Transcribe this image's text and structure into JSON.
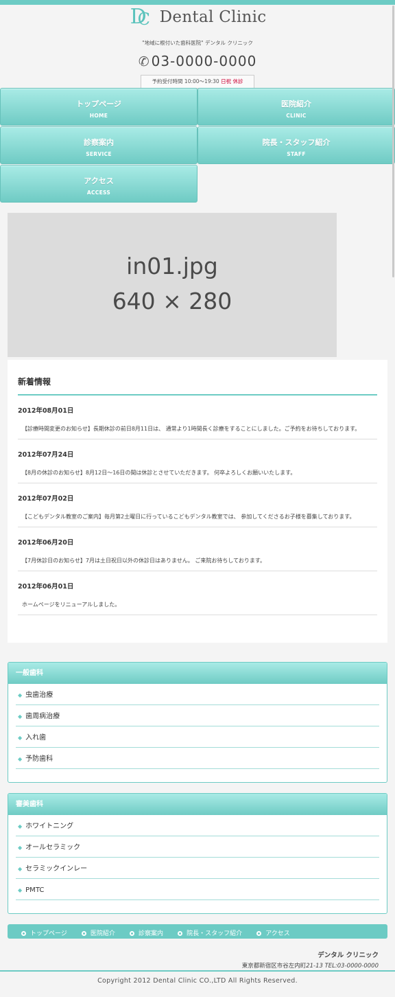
{
  "colors": {
    "accent": "#6ccbc4",
    "holiday": "#cc0033",
    "hero_bg": "#dcdcdc"
  },
  "header": {
    "logo_mark": "DC",
    "logo_text": "Dental Clinic",
    "catch": "\"地域に根付いた歯科医院\" デンタル クリニック",
    "phone_icon": "phone-icon",
    "phone": "03-0000-0000",
    "hours_text": "予約受付時間 10:00～19:30",
    "hours_closed": "日祝 休診"
  },
  "gnav": [
    {
      "jp": "トップページ",
      "en": "HOME"
    },
    {
      "jp": "医院紹介",
      "en": "CLINIC"
    },
    {
      "jp": "診察案内",
      "en": "SERVICE"
    },
    {
      "jp": "院長・スタッフ紹介",
      "en": "STAFF"
    },
    {
      "jp": "アクセス",
      "en": "ACCESS"
    }
  ],
  "hero": {
    "filename": "in01.jpg",
    "size": "640 × 280"
  },
  "news": {
    "title": "新着情報",
    "items": [
      {
        "date": "2012年08月01日",
        "text": "【診療時間変更のお知らせ】長期休診の前日8月11日は、 通常より1時間長く診療をすることにしました。ご予約をお待ちしております。"
      },
      {
        "date": "2012年07月24日",
        "text": "【8月の休診のお知らせ】8月12日～16日の間は休診とさせていただきます。 何卒よろしくお願いいたします。"
      },
      {
        "date": "2012年07月02日",
        "text": "【こどもデンタル教室のご案内】毎月第2土曜日に行っているこどもデンタル教室では、 参加してくださるお子様を募集しております。"
      },
      {
        "date": "2012年06月20日",
        "text": "【7月休診日のお知らせ】7月は土日祝日以外の休診日はありません。 ご来院お待ちしております。"
      },
      {
        "date": "2012年06月01日",
        "text": "ホームページをリニューアルしました。"
      }
    ]
  },
  "general": {
    "title": "一般歯科",
    "items": [
      "虫歯治療",
      "歯周病治療",
      "入れ歯",
      "予防歯科"
    ]
  },
  "cosmetic": {
    "title": "審美歯科",
    "items": [
      "ホワイトニング",
      "オールセラミック",
      "セラミックインレー",
      "PMTC"
    ]
  },
  "footer_nav": [
    "トップページ",
    "医院紹介",
    "診察案内",
    "院長・スタッフ紹介",
    "アクセス"
  ],
  "footer": {
    "name": "デンタル クリニック",
    "address": "東京都新宿区市谷左内町",
    "address_no": "21-13",
    "tel": "TEL:03-0000-0000",
    "copyright": "Copyright 2012 Dental Clinic CO.,LTD All Rights Reserved."
  }
}
